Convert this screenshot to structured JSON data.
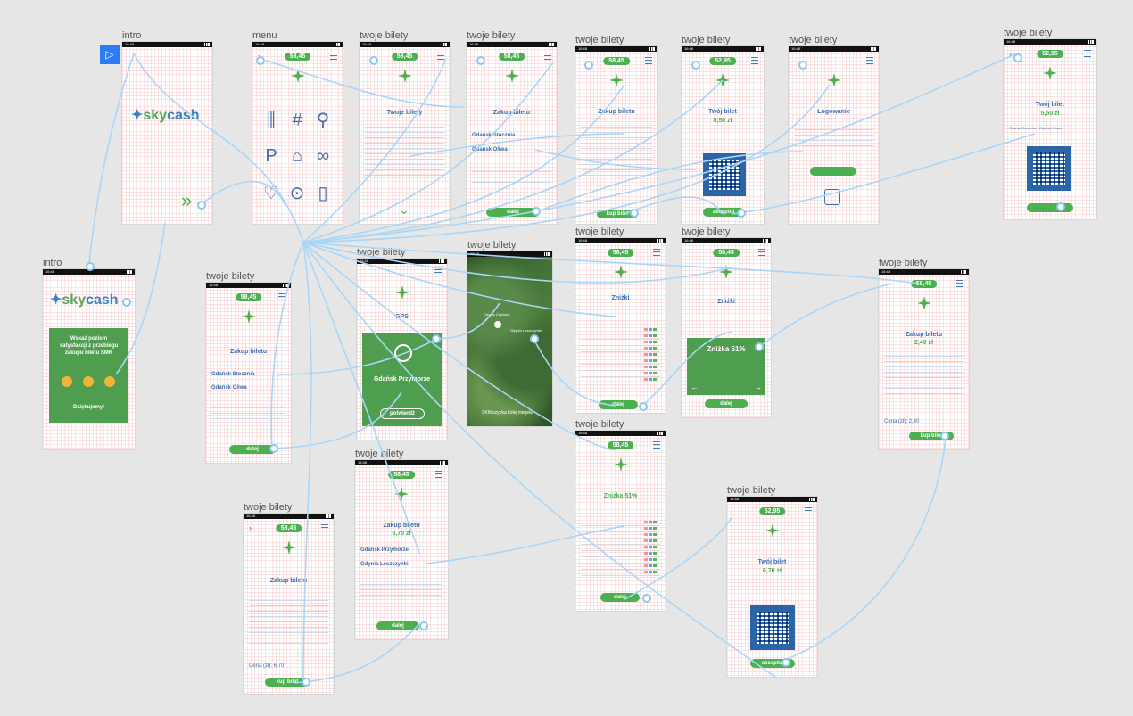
{
  "boards": [
    {
      "id": "b1",
      "title": "intro",
      "status_time": "16:48",
      "type": "intro_logo"
    },
    {
      "id": "b2",
      "title": "menu",
      "status_time": "16:48",
      "balance": "58,45",
      "type": "menu"
    },
    {
      "id": "b3",
      "title": "twoje bilety",
      "status_time": "16:48",
      "balance": "58,45",
      "screen_title": "Twoje bilety",
      "type": "list"
    },
    {
      "id": "b4",
      "title": "twoje bilety",
      "status_time": "16:48",
      "balance": "58,45",
      "screen_title": "Zakup biletu",
      "from": "Gdańsk Stocznia",
      "to": "Gdańsk Oliwa",
      "button": "dalej",
      "type": "purchase"
    },
    {
      "id": "b5",
      "title": "twoje bilety",
      "status_time": "16:48",
      "balance": "58,45",
      "screen_title": "Zakup biletu",
      "button": "kup bilet",
      "type": "form"
    },
    {
      "id": "b6",
      "title": "twoje bilety",
      "status_time": "16:48",
      "balance": "52,95",
      "screen_title": "Twój bilet",
      "price": "5,50 zł",
      "button": "akceptuj",
      "type": "ticket"
    },
    {
      "id": "b7",
      "title": "twoje bilety",
      "status_time": "16:48",
      "screen_title": "Logowanie",
      "type": "login"
    },
    {
      "id": "b8",
      "title": "twoje bilety",
      "status_time": "16:48",
      "balance": "52,95",
      "screen_title": "Twój bilet",
      "price": "5,50 zł",
      "relation": "Gdańsk Stocznia - Gdańsk Oliwa",
      "type": "ticket_big"
    },
    {
      "id": "b9",
      "title": "intro",
      "status_time": "16:48",
      "type": "survey",
      "survey_text": "Wskaż poziom satysfakcji z przebiegu zakupu biletu SMK",
      "thanks": "Dziękujemy!"
    },
    {
      "id": "b10",
      "title": "twoje bilety",
      "status_time": "16:48",
      "balance": "58,45",
      "screen_title": "Zakup biletu",
      "from": "Gdańsk Stocznia",
      "to": "Gdańsk Oliwa",
      "button": "dalej",
      "type": "purchase"
    },
    {
      "id": "b11",
      "title": "twoje bilety",
      "status_time": "16:48",
      "screen_title": "GPS",
      "station": "Gdańsk Przymorze",
      "button": "potwierdź",
      "type": "gps"
    },
    {
      "id": "b12",
      "title": "twoje bilety",
      "status_time": "16:48",
      "map_label_a": "Gdynia Chylonia",
      "map_label_b": "Gdynia Leszczyński",
      "footer": "SKM szybka kolej miejska",
      "type": "map"
    },
    {
      "id": "b13",
      "title": "twoje bilety",
      "status_time": "16:48",
      "balance": "58,45",
      "screen_title": "Zniżki",
      "button": "dalej",
      "type": "discounts"
    },
    {
      "id": "b14",
      "title": "twoje bilety",
      "status_time": "16:48",
      "balance": "58,45",
      "screen_title": "Zniżki",
      "discount_title": "Zniżka 51%",
      "button": "dalej",
      "type": "discount_card"
    },
    {
      "id": "b15",
      "title": "twoje bilety",
      "status_time": "16:48",
      "balance": "58,45",
      "screen_title": "Zakup biletu",
      "price": "2,40 zł",
      "total": "Cena (zł): 2,40",
      "button": "kup bilet",
      "type": "form2"
    },
    {
      "id": "b16",
      "title": "twoje bilety",
      "status_time": "16:48",
      "balance": "58,45",
      "screen_title": "Zakup biletu",
      "from": "Gdańsk Przymorze",
      "to": "Gdynia Leszczynki",
      "price": "6,70 zł",
      "button": "dalej",
      "type": "purchase2"
    },
    {
      "id": "b17",
      "title": "twoje bilety",
      "status_time": "16:48",
      "balance": "58,45",
      "screen_title": "Zniżka 51%",
      "button": "dalej",
      "type": "discounts2"
    },
    {
      "id": "b18",
      "title": "twoje bilety",
      "status_time": "16:48",
      "balance": "52,95",
      "screen_title": "Twój bilet",
      "price": "6,70 zł",
      "button": "akceptuj",
      "type": "ticket"
    },
    {
      "id": "b19",
      "title": "twoje bilety",
      "status_time": "16:48",
      "balance": "58,45",
      "screen_title": "Zakup biletu",
      "total": "Cena (zł): 6,70",
      "button": "kup bilet",
      "type": "form3"
    }
  ],
  "logo": {
    "sky": "sky",
    "cash": "cash"
  },
  "colors": {
    "accent": "#4caf50",
    "brand_blue": "#3b6fb0",
    "wire": "#a9d6f7",
    "canvas": "#e6e6e6"
  }
}
